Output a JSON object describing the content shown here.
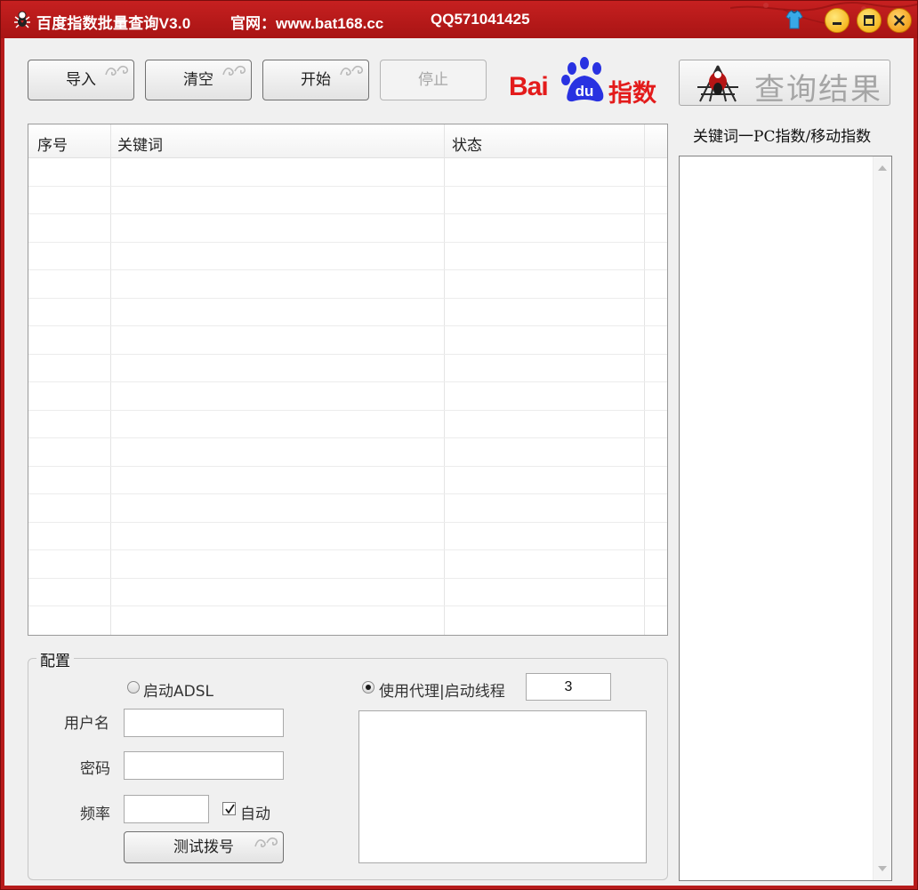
{
  "window": {
    "title": "百度指数批量查询V3.0",
    "website": "官网：www.bat168.cc",
    "qq": "QQ571041425",
    "controls": [
      "skin",
      "minimize",
      "maximize",
      "close"
    ]
  },
  "toolbar": {
    "import_label": "导入",
    "clear_label": "清空",
    "start_label": "开始",
    "stop_label": "停止"
  },
  "logo": {
    "bai": "Bai",
    "du": "du",
    "index": "指数"
  },
  "query_results_button": "查询结果",
  "table": {
    "columns": [
      "序号",
      "关键词",
      "状态"
    ],
    "rows": []
  },
  "results": {
    "header": "关键词一PC指数/移动指数",
    "items": []
  },
  "config": {
    "title": "配置",
    "adsl_label": "启动ADSL",
    "adsl_selected": false,
    "username_label": "用户名",
    "username_value": "",
    "password_label": "密码",
    "password_value": "",
    "frequency_label": "频率",
    "frequency_value": "",
    "auto_label": "自动",
    "auto_checked": true,
    "dial_test_label": "测试拨号",
    "proxy_label": "使用代理|启动线程",
    "proxy_selected": true,
    "threads_value": "3",
    "proxy_list": ""
  },
  "colors": {
    "titlebar": "#b71c1c",
    "baidu_red": "#e31b1b",
    "baidu_blue": "#2932e1"
  }
}
